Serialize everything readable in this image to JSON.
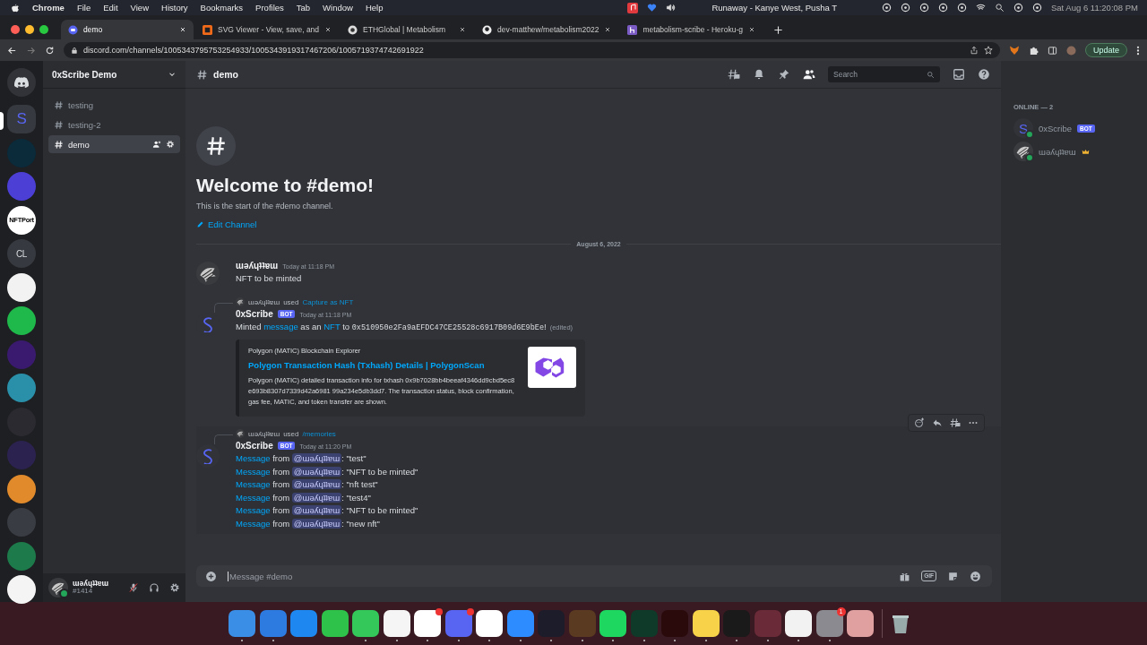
{
  "menubar": {
    "app": "Chrome",
    "menus": [
      "File",
      "Edit",
      "View",
      "History",
      "Bookmarks",
      "Profiles",
      "Tab",
      "Window",
      "Help"
    ],
    "now_playing": "Runaway - Kanye West, Pusha T",
    "clock": "Sat Aug 6  11:20:08 PM"
  },
  "browser": {
    "tabs": [
      {
        "title": "demo",
        "selected": true
      },
      {
        "title": "SVG Viewer - View, save, and",
        "selected": false
      },
      {
        "title": "ETHGlobal | Metabolism",
        "selected": false
      },
      {
        "title": "dev-matthew/metabolism2022",
        "selected": false
      },
      {
        "title": "metabolism-scribe - Heroku-g",
        "selected": false
      }
    ],
    "url": "discord.com/channels/1005343795753254933/1005343919317467206/1005719374742691922",
    "update_button": "Update"
  },
  "servers": [
    {
      "kind": "home",
      "selected": false
    },
    {
      "kind": "text",
      "label": "S",
      "color": "#36393f",
      "selected": true
    },
    {
      "kind": "logo",
      "color": "#0b2a3a",
      "selected": false
    },
    {
      "kind": "logo",
      "color": "#4b3fd6",
      "selected": false
    },
    {
      "kind": "text",
      "label": "NFTPort",
      "color": "#ffffff",
      "selected": false
    },
    {
      "kind": "text",
      "label": "CL",
      "color": "#36393f",
      "selected": false
    },
    {
      "kind": "logo",
      "color": "#f2f2f2",
      "selected": false
    },
    {
      "kind": "logo",
      "color": "#1fb84a",
      "selected": false
    },
    {
      "kind": "logo",
      "color": "#3a1a6e",
      "selected": false
    },
    {
      "kind": "logo",
      "color": "#2a8fa8",
      "selected": false
    },
    {
      "kind": "logo",
      "color": "#2a2a30",
      "selected": false
    },
    {
      "kind": "logo",
      "color": "#2c2250",
      "selected": false
    },
    {
      "kind": "logo",
      "color": "#e08a2c",
      "selected": false
    },
    {
      "kind": "logo",
      "color": "#3a3c44",
      "selected": false
    },
    {
      "kind": "logo",
      "color": "#1d7a4a",
      "selected": false
    },
    {
      "kind": "logo",
      "color": "#f4f4f4",
      "selected": false
    }
  ],
  "sidebar": {
    "server_name": "0xScribe Demo",
    "channels": [
      {
        "name": "testing",
        "selected": false
      },
      {
        "name": "testing-2",
        "selected": false
      },
      {
        "name": "demo",
        "selected": true
      }
    ],
    "user": {
      "name": "ɯəʎɥʇʇɐɯ",
      "tag": "#1414"
    }
  },
  "channel_header": {
    "name": "demo",
    "search_placeholder": "Search"
  },
  "welcome": {
    "title": "Welcome to #demo!",
    "subtitle": "This is the start of the #demo channel.",
    "edit_link": "Edit Channel"
  },
  "date_divider": "August 6, 2022",
  "messages": [
    {
      "kind": "user",
      "author": "ɯəʎɥʇʇɐɯ",
      "time": "Today at 11:18 PM",
      "text": "NFT to be minted"
    },
    {
      "kind": "bot",
      "reply": {
        "user": "ɯəʎɥʇʇɐɯ",
        "verb": "used",
        "command": "Capture as NFT"
      },
      "author": "0xScribe",
      "badge": "BOT",
      "time": "Today at 11:18 PM",
      "hovered": false,
      "segments": [
        {
          "kind": "plain",
          "text": "Minted "
        },
        {
          "kind": "link",
          "text": "message"
        },
        {
          "kind": "plain",
          "text": " as an "
        },
        {
          "kind": "link",
          "text": "NFT"
        },
        {
          "kind": "plain",
          "text": " to "
        },
        {
          "kind": "code",
          "text": "0x510950e2Fa9aEFDC47CE25528c6917B09d6E9bEe"
        },
        {
          "kind": "plain",
          "text": "!"
        }
      ],
      "edited": "(edited)",
      "embed": {
        "provider": "Polygon (MATIC) Blockchain Explorer",
        "title": "Polygon Transaction Hash (Txhash) Details | PolygonScan",
        "description": "Polygon (MATIC) detailed transaction info for txhash 0x9b7028bb4beeaf4346dd9cbd5ec8e693b8307d7339d42a6981 99a234e5db3dd7. The transaction status, block confirmation, gas fee, MATIC, and token transfer are shown."
      }
    },
    {
      "kind": "bot",
      "reply": {
        "user": "ɯəʎɥʇʇɐɯ",
        "verb": "used",
        "command": "/memories"
      },
      "author": "0xScribe",
      "badge": "BOT",
      "time": "Today at 11:20 PM",
      "hovered": true,
      "lines": [
        {
          "link": "Message",
          "middle": " from ",
          "mention": "@ɯəʎɥʇʇɐɯ",
          "quote": ": \"test\""
        },
        {
          "link": "Message",
          "middle": " from ",
          "mention": "@ɯəʎɥʇʇɐɯ",
          "quote": ": \"NFT to be minted\""
        },
        {
          "link": "Message",
          "middle": " from ",
          "mention": "@ɯəʎɥʇʇɐɯ",
          "quote": ": \"nft test\""
        },
        {
          "link": "Message",
          "middle": " from ",
          "mention": "@ɯəʎɥʇʇɐɯ",
          "quote": ": \"test4\""
        },
        {
          "link": "Message",
          "middle": " from ",
          "mention": "@ɯəʎɥʇʇɐɯ",
          "quote": ": \"NFT to be minted\""
        },
        {
          "link": "Message",
          "middle": " from ",
          "mention": "@ɯəʎɥʇʇɐɯ",
          "quote": ": \"new nft\""
        }
      ]
    }
  ],
  "composer": {
    "placeholder": "Message #demo",
    "gif_label": "GIF"
  },
  "members": {
    "heading": "ONLINE — 2",
    "list": [
      {
        "name": "0xScribe",
        "badge": "BOT",
        "kind": "letter",
        "letter": "S",
        "owner": false
      },
      {
        "name": "ɯəʎɥʇʇɐɯ",
        "kind": "photo",
        "owner": true
      }
    ]
  },
  "dock": [
    {
      "color": "#3a8ee6",
      "running": true
    },
    {
      "color": "#2d7be0",
      "running": true
    },
    {
      "color": "#1e88f0",
      "running": false
    },
    {
      "color": "#2fc24a",
      "running": false
    },
    {
      "color": "#34c85a",
      "running": true
    },
    {
      "color": "#f5f5f5",
      "running": true
    },
    {
      "color": "#ffffff",
      "running": true,
      "notified": true
    },
    {
      "color": "#5865f2",
      "running": true,
      "notified": true
    },
    {
      "color": "#ffffff",
      "running": true
    },
    {
      "color": "#2d8cff",
      "running": true
    },
    {
      "color": "#1c1c2a",
      "running": true
    },
    {
      "color": "#5a3a20",
      "running": true
    },
    {
      "color": "#1ed760",
      "running": true
    },
    {
      "color": "#0f3a2a",
      "running": true
    },
    {
      "color": "#2a0a0a",
      "running": true
    },
    {
      "color": "#f8d34a",
      "running": true
    },
    {
      "color": "#1a1a1a",
      "running": true
    },
    {
      "color": "#6a2a38",
      "running": true
    },
    {
      "color": "#f2f2f2",
      "running": true
    },
    {
      "color": "#8a8a90",
      "running": true,
      "badge_count": "1"
    },
    {
      "color": "#e0a0a0",
      "running": false
    }
  ]
}
